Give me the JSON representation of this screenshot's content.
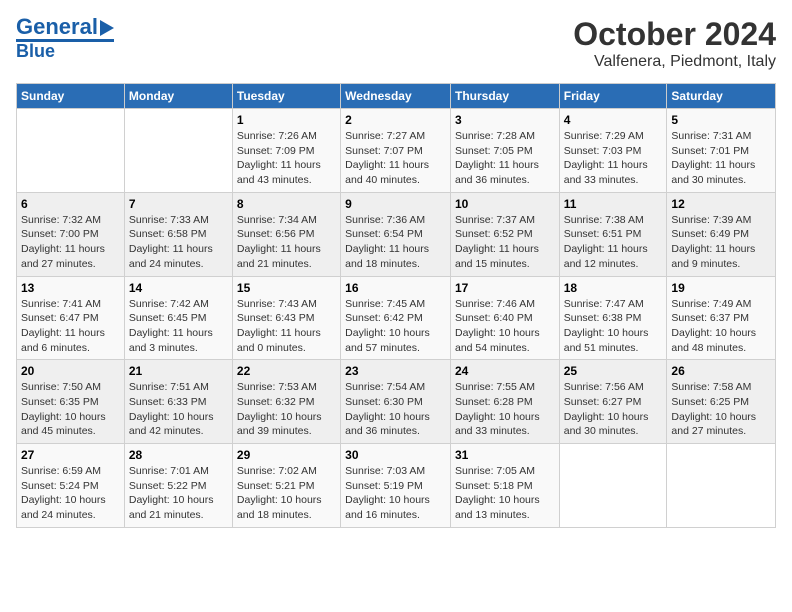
{
  "header": {
    "logo_general": "General",
    "logo_blue": "Blue",
    "title": "October 2024",
    "subtitle": "Valfenera, Piedmont, Italy"
  },
  "calendar": {
    "days_of_week": [
      "Sunday",
      "Monday",
      "Tuesday",
      "Wednesday",
      "Thursday",
      "Friday",
      "Saturday"
    ],
    "weeks": [
      [
        {
          "day": "",
          "info": ""
        },
        {
          "day": "",
          "info": ""
        },
        {
          "day": "1",
          "info": "Sunrise: 7:26 AM\nSunset: 7:09 PM\nDaylight: 11 hours and 43 minutes."
        },
        {
          "day": "2",
          "info": "Sunrise: 7:27 AM\nSunset: 7:07 PM\nDaylight: 11 hours and 40 minutes."
        },
        {
          "day": "3",
          "info": "Sunrise: 7:28 AM\nSunset: 7:05 PM\nDaylight: 11 hours and 36 minutes."
        },
        {
          "day": "4",
          "info": "Sunrise: 7:29 AM\nSunset: 7:03 PM\nDaylight: 11 hours and 33 minutes."
        },
        {
          "day": "5",
          "info": "Sunrise: 7:31 AM\nSunset: 7:01 PM\nDaylight: 11 hours and 30 minutes."
        }
      ],
      [
        {
          "day": "6",
          "info": "Sunrise: 7:32 AM\nSunset: 7:00 PM\nDaylight: 11 hours and 27 minutes."
        },
        {
          "day": "7",
          "info": "Sunrise: 7:33 AM\nSunset: 6:58 PM\nDaylight: 11 hours and 24 minutes."
        },
        {
          "day": "8",
          "info": "Sunrise: 7:34 AM\nSunset: 6:56 PM\nDaylight: 11 hours and 21 minutes."
        },
        {
          "day": "9",
          "info": "Sunrise: 7:36 AM\nSunset: 6:54 PM\nDaylight: 11 hours and 18 minutes."
        },
        {
          "day": "10",
          "info": "Sunrise: 7:37 AM\nSunset: 6:52 PM\nDaylight: 11 hours and 15 minutes."
        },
        {
          "day": "11",
          "info": "Sunrise: 7:38 AM\nSunset: 6:51 PM\nDaylight: 11 hours and 12 minutes."
        },
        {
          "day": "12",
          "info": "Sunrise: 7:39 AM\nSunset: 6:49 PM\nDaylight: 11 hours and 9 minutes."
        }
      ],
      [
        {
          "day": "13",
          "info": "Sunrise: 7:41 AM\nSunset: 6:47 PM\nDaylight: 11 hours and 6 minutes."
        },
        {
          "day": "14",
          "info": "Sunrise: 7:42 AM\nSunset: 6:45 PM\nDaylight: 11 hours and 3 minutes."
        },
        {
          "day": "15",
          "info": "Sunrise: 7:43 AM\nSunset: 6:43 PM\nDaylight: 11 hours and 0 minutes."
        },
        {
          "day": "16",
          "info": "Sunrise: 7:45 AM\nSunset: 6:42 PM\nDaylight: 10 hours and 57 minutes."
        },
        {
          "day": "17",
          "info": "Sunrise: 7:46 AM\nSunset: 6:40 PM\nDaylight: 10 hours and 54 minutes."
        },
        {
          "day": "18",
          "info": "Sunrise: 7:47 AM\nSunset: 6:38 PM\nDaylight: 10 hours and 51 minutes."
        },
        {
          "day": "19",
          "info": "Sunrise: 7:49 AM\nSunset: 6:37 PM\nDaylight: 10 hours and 48 minutes."
        }
      ],
      [
        {
          "day": "20",
          "info": "Sunrise: 7:50 AM\nSunset: 6:35 PM\nDaylight: 10 hours and 45 minutes."
        },
        {
          "day": "21",
          "info": "Sunrise: 7:51 AM\nSunset: 6:33 PM\nDaylight: 10 hours and 42 minutes."
        },
        {
          "day": "22",
          "info": "Sunrise: 7:53 AM\nSunset: 6:32 PM\nDaylight: 10 hours and 39 minutes."
        },
        {
          "day": "23",
          "info": "Sunrise: 7:54 AM\nSunset: 6:30 PM\nDaylight: 10 hours and 36 minutes."
        },
        {
          "day": "24",
          "info": "Sunrise: 7:55 AM\nSunset: 6:28 PM\nDaylight: 10 hours and 33 minutes."
        },
        {
          "day": "25",
          "info": "Sunrise: 7:56 AM\nSunset: 6:27 PM\nDaylight: 10 hours and 30 minutes."
        },
        {
          "day": "26",
          "info": "Sunrise: 7:58 AM\nSunset: 6:25 PM\nDaylight: 10 hours and 27 minutes."
        }
      ],
      [
        {
          "day": "27",
          "info": "Sunrise: 6:59 AM\nSunset: 5:24 PM\nDaylight: 10 hours and 24 minutes."
        },
        {
          "day": "28",
          "info": "Sunrise: 7:01 AM\nSunset: 5:22 PM\nDaylight: 10 hours and 21 minutes."
        },
        {
          "day": "29",
          "info": "Sunrise: 7:02 AM\nSunset: 5:21 PM\nDaylight: 10 hours and 18 minutes."
        },
        {
          "day": "30",
          "info": "Sunrise: 7:03 AM\nSunset: 5:19 PM\nDaylight: 10 hours and 16 minutes."
        },
        {
          "day": "31",
          "info": "Sunrise: 7:05 AM\nSunset: 5:18 PM\nDaylight: 10 hours and 13 minutes."
        },
        {
          "day": "",
          "info": ""
        },
        {
          "day": "",
          "info": ""
        }
      ]
    ]
  }
}
